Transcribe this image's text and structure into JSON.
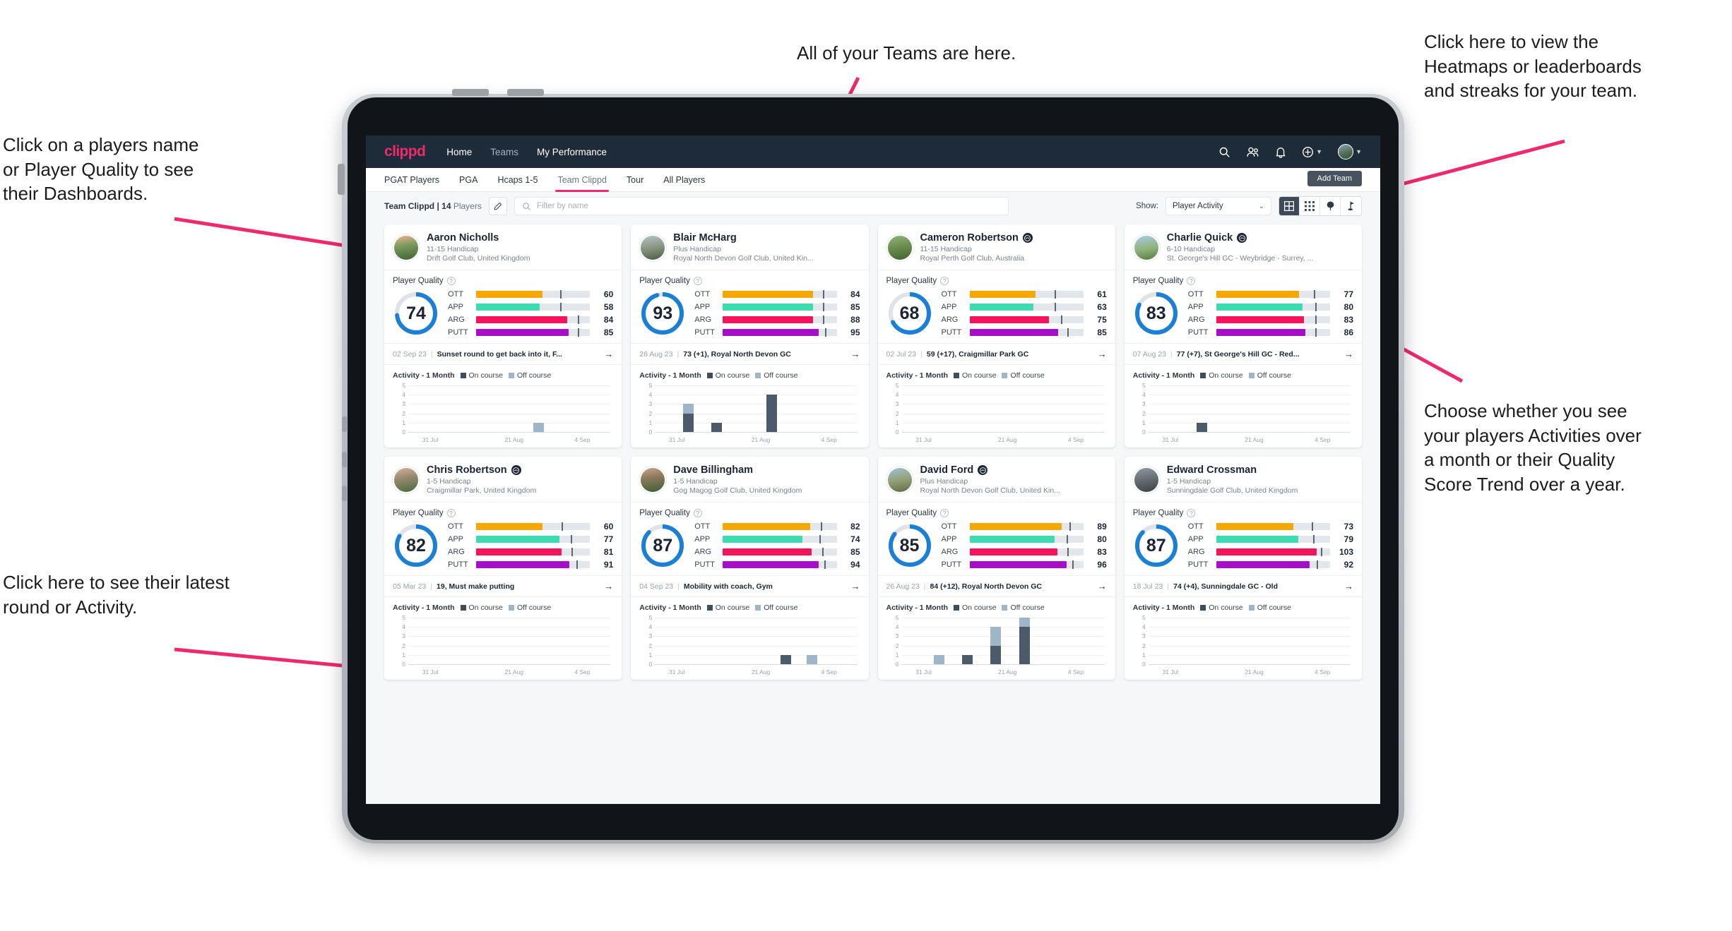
{
  "annotations": [
    {
      "id": "teams",
      "text": "All of your Teams are here."
    },
    {
      "id": "heatmaps",
      "text": "Click here to view the\nHeatmaps or leaderboards\nand streaks for your team."
    },
    {
      "id": "player-name",
      "text": "Click on a players name\nor Player Quality to see\ntheir Dashboards."
    },
    {
      "id": "activity-choice",
      "text": "Choose whether you see\nyour players Activities over\na month or their Quality\nScore Trend over a year."
    },
    {
      "id": "latest-round",
      "text": "Click here to see their latest\nround or Activity."
    }
  ],
  "app": {
    "brand": "clippd",
    "nav_links": [
      {
        "label": "Home",
        "active": true
      },
      {
        "label": "Teams",
        "active": false
      },
      {
        "label": "My Performance",
        "active": true
      }
    ],
    "nav_icons": [
      {
        "name": "search-icon"
      },
      {
        "name": "people-icon"
      },
      {
        "name": "bell-icon"
      },
      {
        "name": "plus-circle-icon"
      },
      {
        "name": "avatar"
      }
    ],
    "subtabs": [
      {
        "label": "PGAT Players",
        "active": false
      },
      {
        "label": "PGA",
        "active": false
      },
      {
        "label": "Hcaps 1-5",
        "active": false
      },
      {
        "label": "Team Clippd",
        "active": true
      },
      {
        "label": "Tour",
        "active": false
      },
      {
        "label": "All Players",
        "active": false
      }
    ],
    "add_team_label": "Add Team",
    "toolbar": {
      "team_label_bold": "Team Clippd | 14",
      "team_label_light": " Players",
      "edit_icon": "pencil-icon",
      "search_placeholder": "Filter by name",
      "search_value": "",
      "show_label": "Show:",
      "show_value": "Player Activity",
      "show_options": [
        "Player Activity",
        "Quality Score Trend"
      ],
      "view_buttons": [
        {
          "name": "grid-large-view",
          "active": true
        },
        {
          "name": "grid-small-view",
          "active": false
        },
        {
          "name": "heatmap-view",
          "active": false
        },
        {
          "name": "leaderboard-view",
          "active": false
        }
      ]
    }
  },
  "card_labels": {
    "player_quality": "Player Quality",
    "help_icon": "question-icon",
    "activity_title": "Activity - 1 Month",
    "legend_on": "On course",
    "legend_off": "Off course",
    "arrow_icon": "arrow-right-icon"
  },
  "metric_colors": {
    "OTT": "#f5a800",
    "APP": "#3ddcb0",
    "ARG": "#f5145c",
    "PUTT": "#a50fc8",
    "ring": "#1b7fd4",
    "ring_track": "#dfe3e8"
  },
  "chart_data": {
    "type": "bar",
    "title": "Activity - 1 Month",
    "ylabel": "",
    "xlabel": "",
    "ylim": [
      0,
      5
    ],
    "yticks": [
      0,
      1,
      2,
      3,
      4,
      5
    ],
    "xticks": [
      "31 Jul",
      "21 Aug",
      "4 Sep"
    ],
    "grid": true,
    "legend": [
      "On course",
      "Off course"
    ],
    "stacked": true,
    "panels": [
      {
        "player": "Aaron Nicholls",
        "bars": [
          {
            "pos": 0.62,
            "on": 0,
            "off": 1
          }
        ]
      },
      {
        "player": "Blair McHarg",
        "bars": [
          {
            "pos": 0.14,
            "on": 2,
            "off": 1
          },
          {
            "pos": 0.28,
            "on": 1,
            "off": 0
          },
          {
            "pos": 0.55,
            "on": 4,
            "off": 0
          }
        ]
      },
      {
        "player": "Cameron Robertson",
        "bars": []
      },
      {
        "player": "Charlie Quick",
        "bars": [
          {
            "pos": 0.24,
            "on": 1,
            "off": 0
          }
        ]
      },
      {
        "player": "Chris Robertson",
        "bars": []
      },
      {
        "player": "Dave Billingham",
        "bars": [
          {
            "pos": 0.62,
            "on": 1,
            "off": 0
          },
          {
            "pos": 0.75,
            "on": 0,
            "off": 1
          }
        ]
      },
      {
        "player": "David Ford",
        "bars": [
          {
            "pos": 0.16,
            "on": 0,
            "off": 1
          },
          {
            "pos": 0.3,
            "on": 1,
            "off": 0
          },
          {
            "pos": 0.44,
            "on": 2,
            "off": 2
          },
          {
            "pos": 0.58,
            "on": 4,
            "off": 1
          }
        ]
      },
      {
        "player": "Edward Crossman",
        "bars": []
      }
    ]
  },
  "players": [
    {
      "name": "Aaron Nicholls",
      "verified": false,
      "avatar": "av1",
      "handicap": "11-15 Handicap",
      "club": "Drift Golf Club, United Kingdom",
      "quality": 74,
      "ring_pct": 74,
      "metrics": [
        {
          "label": "OTT",
          "value": 60,
          "fill": 58,
          "tick": 74
        },
        {
          "label": "APP",
          "value": 58,
          "fill": 56,
          "tick": 74
        },
        {
          "label": "ARG",
          "value": 84,
          "fill": 80,
          "tick": 89
        },
        {
          "label": "PUTT",
          "value": 85,
          "fill": 81,
          "tick": 89
        }
      ],
      "round_date": "02 Sep 23",
      "round_text": "Sunset round to get back into it, F..."
    },
    {
      "name": "Blair McHarg",
      "verified": false,
      "avatar": "av2",
      "handicap": "Plus Handicap",
      "club": "Royal North Devon Golf Club, United Kin...",
      "quality": 93,
      "ring_pct": 96,
      "metrics": [
        {
          "label": "OTT",
          "value": 84,
          "fill": 79,
          "tick": 88
        },
        {
          "label": "APP",
          "value": 85,
          "fill": 79,
          "tick": 88
        },
        {
          "label": "ARG",
          "value": 88,
          "fill": 79,
          "tick": 88
        },
        {
          "label": "PUTT",
          "value": 95,
          "fill": 84,
          "tick": 90
        }
      ],
      "round_date": "26 Aug 23",
      "round_text": "73 (+1), Royal North Devon GC"
    },
    {
      "name": "Cameron Robertson",
      "verified": true,
      "avatar": "av3",
      "handicap": "11-15 Handicap",
      "club": "Royal Perth Golf Club, Australia",
      "quality": 68,
      "ring_pct": 68,
      "metrics": [
        {
          "label": "OTT",
          "value": 61,
          "fill": 58,
          "tick": 75
        },
        {
          "label": "APP",
          "value": 63,
          "fill": 56,
          "tick": 75
        },
        {
          "label": "ARG",
          "value": 75,
          "fill": 70,
          "tick": 80
        },
        {
          "label": "PUTT",
          "value": 85,
          "fill": 78,
          "tick": 86
        }
      ],
      "round_date": "02 Jul 23",
      "round_text": "59 (+17), Craigmillar Park GC"
    },
    {
      "name": "Charlie Quick",
      "verified": true,
      "avatar": "av4",
      "handicap": "6-10 Handicap",
      "club": "St. George's Hill GC - Weybridge - Surrey, ...",
      "quality": 83,
      "ring_pct": 83,
      "metrics": [
        {
          "label": "OTT",
          "value": 77,
          "fill": 73,
          "tick": 86
        },
        {
          "label": "APP",
          "value": 80,
          "fill": 76,
          "tick": 87
        },
        {
          "label": "ARG",
          "value": 83,
          "fill": 77,
          "tick": 87
        },
        {
          "label": "PUTT",
          "value": 86,
          "fill": 78,
          "tick": 87
        }
      ],
      "round_date": "07 Aug 23",
      "round_text": "77 (+7), St George's Hill GC - Red..."
    },
    {
      "name": "Chris Robertson",
      "verified": true,
      "avatar": "av5",
      "handicap": "1-5 Handicap",
      "club": "Craigmillar Park, United Kingdom",
      "quality": 82,
      "ring_pct": 84,
      "metrics": [
        {
          "label": "OTT",
          "value": 60,
          "fill": 58,
          "tick": 75
        },
        {
          "label": "APP",
          "value": 77,
          "fill": 73,
          "tick": 83
        },
        {
          "label": "ARG",
          "value": 81,
          "fill": 75,
          "tick": 84
        },
        {
          "label": "PUTT",
          "value": 91,
          "fill": 82,
          "tick": 88
        }
      ],
      "round_date": "05 Mar 23",
      "round_text": "19, Must make putting"
    },
    {
      "name": "Dave Billingham",
      "verified": false,
      "avatar": "av6",
      "handicap": "1-5 Handicap",
      "club": "Gog Magog Golf Club, United Kingdom",
      "quality": 87,
      "ring_pct": 88,
      "metrics": [
        {
          "label": "OTT",
          "value": 82,
          "fill": 77,
          "tick": 86
        },
        {
          "label": "APP",
          "value": 74,
          "fill": 70,
          "tick": 85
        },
        {
          "label": "ARG",
          "value": 85,
          "fill": 78,
          "tick": 87
        },
        {
          "label": "PUTT",
          "value": 94,
          "fill": 84,
          "tick": 89
        }
      ],
      "round_date": "04 Sep 23",
      "round_text": "Mobility with coach, Gym"
    },
    {
      "name": "David Ford",
      "verified": true,
      "avatar": "av7",
      "handicap": "Plus Handicap",
      "club": "Royal North Devon Golf Club, United Kin...",
      "quality": 85,
      "ring_pct": 86,
      "metrics": [
        {
          "label": "OTT",
          "value": 89,
          "fill": 81,
          "tick": 88
        },
        {
          "label": "APP",
          "value": 80,
          "fill": 75,
          "tick": 85
        },
        {
          "label": "ARG",
          "value": 83,
          "fill": 77,
          "tick": 86
        },
        {
          "label": "PUTT",
          "value": 96,
          "fill": 85,
          "tick": 90
        }
      ],
      "round_date": "26 Aug 23",
      "round_text": "84 (+12), Royal North Devon GC"
    },
    {
      "name": "Edward Crossman",
      "verified": false,
      "avatar": "av8",
      "handicap": "1-5 Handicap",
      "club": "Sunningdale Golf Club, United Kingdom",
      "quality": 87,
      "ring_pct": 88,
      "metrics": [
        {
          "label": "OTT",
          "value": 73,
          "fill": 68,
          "tick": 84
        },
        {
          "label": "APP",
          "value": 79,
          "fill": 72,
          "tick": 85
        },
        {
          "label": "ARG",
          "value": 103,
          "fill": 88,
          "tick": 92
        },
        {
          "label": "PUTT",
          "value": 92,
          "fill": 82,
          "tick": 88
        }
      ],
      "round_date": "18 Jul 23",
      "round_text": "74 (+4), Sunningdale GC - Old"
    }
  ]
}
